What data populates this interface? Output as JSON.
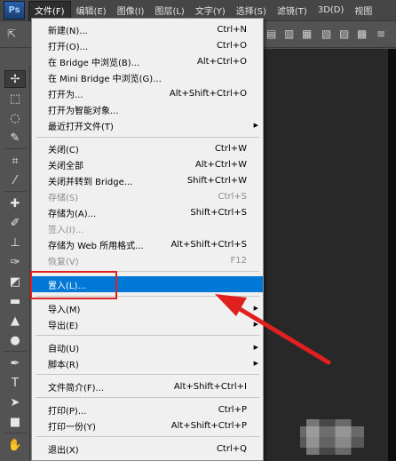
{
  "app": {
    "logo": "Ps"
  },
  "menubar": {
    "items": [
      {
        "label": "文件(F)"
      },
      {
        "label": "编辑(E)"
      },
      {
        "label": "图像(I)"
      },
      {
        "label": "图层(L)"
      },
      {
        "label": "文字(Y)"
      },
      {
        "label": "选择(S)"
      },
      {
        "label": "滤镜(T)"
      },
      {
        "label": "3D(D)"
      },
      {
        "label": "视图"
      }
    ]
  },
  "file_menu": {
    "items": [
      {
        "label": "新建(N)...",
        "shortcut": "Ctrl+N"
      },
      {
        "label": "打开(O)...",
        "shortcut": "Ctrl+O"
      },
      {
        "label": "在 Bridge 中浏览(B)...",
        "shortcut": "Alt+Ctrl+O"
      },
      {
        "label": "在 Mini Bridge 中浏览(G)...",
        "shortcut": ""
      },
      {
        "label": "打开为...",
        "shortcut": "Alt+Shift+Ctrl+O"
      },
      {
        "label": "打开为智能对象...",
        "shortcut": ""
      },
      {
        "label": "最近打开文件(T)",
        "shortcut": ""
      },
      {
        "label": "关闭(C)",
        "shortcut": "Ctrl+W"
      },
      {
        "label": "关闭全部",
        "shortcut": "Alt+Ctrl+W"
      },
      {
        "label": "关闭并转到 Bridge...",
        "shortcut": "Shift+Ctrl+W"
      },
      {
        "label": "存储(S)",
        "shortcut": "Ctrl+S"
      },
      {
        "label": "存储为(A)...",
        "shortcut": "Shift+Ctrl+S"
      },
      {
        "label": "签入(I)...",
        "shortcut": ""
      },
      {
        "label": "存储为 Web 所用格式...",
        "shortcut": "Alt+Shift+Ctrl+S"
      },
      {
        "label": "恢复(V)",
        "shortcut": "F12"
      },
      {
        "label": "置入(L)...",
        "shortcut": ""
      },
      {
        "label": "导入(M)",
        "shortcut": ""
      },
      {
        "label": "导出(E)",
        "shortcut": ""
      },
      {
        "label": "自动(U)",
        "shortcut": ""
      },
      {
        "label": "脚本(R)",
        "shortcut": ""
      },
      {
        "label": "文件简介(F)...",
        "shortcut": "Alt+Shift+Ctrl+I"
      },
      {
        "label": "打印(P)...",
        "shortcut": "Ctrl+P"
      },
      {
        "label": "打印一份(Y)",
        "shortcut": "Alt+Shift+Ctrl+P"
      },
      {
        "label": "退出(X)",
        "shortcut": "Ctrl+Q"
      }
    ]
  },
  "colors": {
    "highlight": "#0078d7",
    "annotation": "#e0201f"
  }
}
